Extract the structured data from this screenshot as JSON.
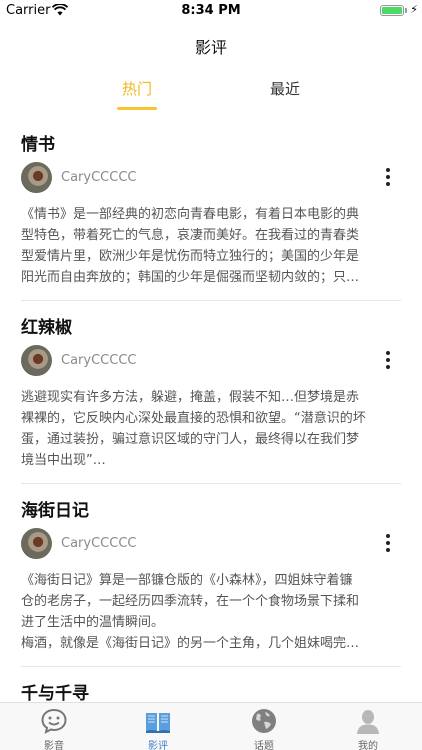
{
  "status": {
    "carrier": "Carrier",
    "time": "8:34 PM"
  },
  "nav": {
    "title": "影评"
  },
  "segments": {
    "hot": "热门",
    "recent": "最近"
  },
  "reviews": [
    {
      "title": "情书",
      "author": "CaryCCCCC",
      "lines": [
        "《情书》是一部经典的初恋向青春电影，有着日本电影的典",
        "型特色，带着死亡的气息，哀凄而美好。在我看过的青春类",
        "型爱情片里，欧洲少年是忧伤而特立独行的；美国的少年是",
        "阳光而自由奔放的；韩国的少年是倔强而坚韧内敛的；只…"
      ]
    },
    {
      "title": "红辣椒",
      "author": "CaryCCCCC",
      "lines": [
        "逃避现实有许多方法，躲避，掩盖，假装不知…但梦境是赤",
        "裸裸的，它反映内心深处最直接的恐惧和欲望。“潜意识的坏",
        "蛋，通过装扮，骗过意识区域的守门人，最终得以在我们梦",
        "境当中出现”…"
      ]
    },
    {
      "title": "海街日记",
      "author": "CaryCCCCC",
      "lines": [
        "《海街日记》算是一部镰仓版的《小森林》，四姐妹守着镰",
        "仓的老房子，一起经历四季流转，在一个个食物场景下揉和",
        "进了生活中的温情瞬间。",
        "梅酒，就像是《海街日记》的另一个主角，几个姐妹喝完…"
      ]
    }
  ],
  "peek": {
    "title": "千与千寻"
  },
  "tabs": [
    {
      "label": "影音",
      "icon": "chat-bubble-icon"
    },
    {
      "label": "影评",
      "icon": "book-icon"
    },
    {
      "label": "话题",
      "icon": "globe-icon"
    },
    {
      "label": "我的",
      "icon": "person-icon"
    }
  ],
  "colors": {
    "accent": "#f0b81b",
    "tab_active": "#3d7fc9"
  }
}
